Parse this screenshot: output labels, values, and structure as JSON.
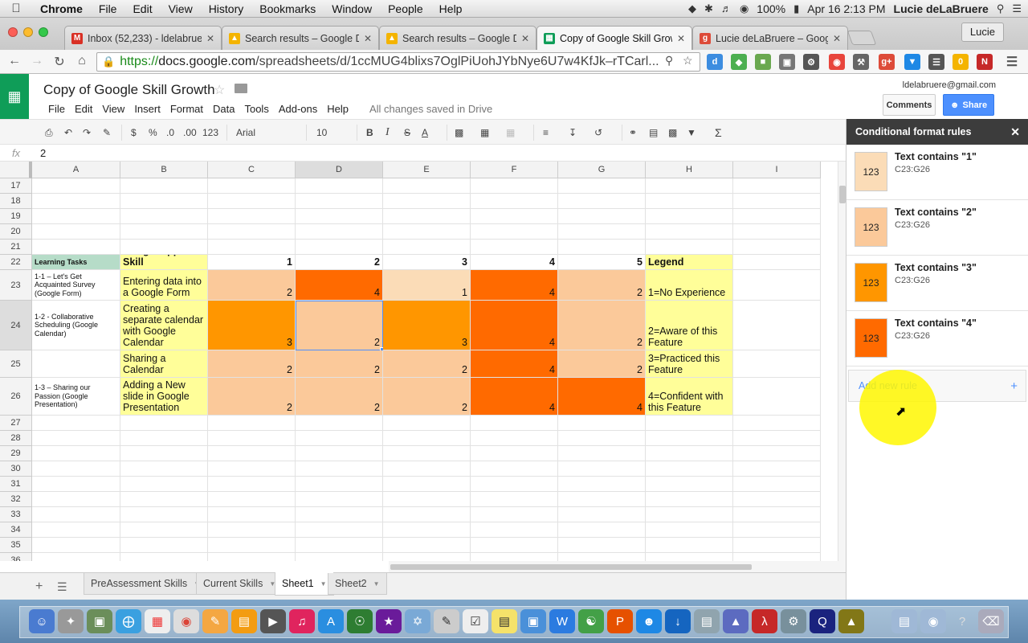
{
  "menubar": {
    "app": "Chrome",
    "items": [
      "File",
      "Edit",
      "View",
      "History",
      "Bookmarks",
      "Window",
      "People",
      "Help"
    ],
    "battery": "100%",
    "datetime": "Apr 16  2:13 PM",
    "user": "Lucie deLaBruere"
  },
  "tabs": [
    {
      "title": "Inbox (52,233) - ldelabrue",
      "icon": "gmail-icon",
      "color": "#d93025"
    },
    {
      "title": "Search results – Google Dr",
      "icon": "drive-icon",
      "color": "#f4b400"
    },
    {
      "title": "Search results – Google Dr",
      "icon": "drive-icon",
      "color": "#f4b400"
    },
    {
      "title": "Copy of Google Skill Growt",
      "icon": "sheets-icon",
      "color": "#0f9d58"
    },
    {
      "title": "Lucie deLaBruere – Google",
      "icon": "gplus-icon",
      "color": "#dd4b39"
    }
  ],
  "profile_button": "Lucie",
  "url": {
    "https": "https://",
    "domain": "docs.google.com",
    "path": "/spreadsheets/d/1ccMUG4blixs7OglPiUohJYbNye6U7w4KfJk–rTCarl..."
  },
  "doc": {
    "title": "Copy of Google Skill Growth",
    "menu": [
      "File",
      "Edit",
      "View",
      "Insert",
      "Format",
      "Data",
      "Tools",
      "Add-ons",
      "Help"
    ],
    "saved": "All changes saved in Drive",
    "account": "ldelabruere@gmail.com",
    "comments": "Comments",
    "share": "Share"
  },
  "toolbar": {
    "currency": "$",
    "percent": "%",
    "dec_less": ".0",
    "dec_more": ".00",
    "format": "123",
    "font": "Arial",
    "size": "10"
  },
  "formula": {
    "fx": "fx",
    "value": "2"
  },
  "columns": [
    "A",
    "B",
    "C",
    "D",
    "E",
    "F",
    "G",
    "H",
    "I"
  ],
  "rows_before": [
    "17",
    "18",
    "19",
    "20",
    "21"
  ],
  "table": {
    "header": {
      "row": "22",
      "a": "Learning Tasks",
      "b": "Google Apps Skill",
      "c": "1",
      "d": "2",
      "e": "3",
      "f": "4",
      "g": "5",
      "h": "Legend"
    },
    "rows": [
      {
        "row": "23",
        "a": "1-1 – Let's Get Acquainted Survey (Google Form)",
        "b": "Entering data into a Google Form",
        "c": "2",
        "d": "4",
        "e": "1",
        "f": "4",
        "g": "2",
        "h": "1=No Experience"
      },
      {
        "row": "24",
        "a": "1-2 -  Collaborative Scheduling (Google Calendar)",
        "b": "Creating a separate calendar with Google Calendar",
        "c": "3",
        "d": "2",
        "e": "3",
        "f": "4",
        "g": "2",
        "h": "2=Aware of this Feature"
      },
      {
        "row": "25",
        "a": "",
        "b": "Sharing a Calendar",
        "c": "2",
        "d": "2",
        "e": "2",
        "f": "4",
        "g": "2",
        "h": "3=Practiced this Feature"
      },
      {
        "row": "26",
        "a": "1-3 – Sharing our Passion (Google Presentation)",
        "b": "Adding a New slide in Google Presentation",
        "c": "2",
        "d": "2",
        "e": "2",
        "f": "4",
        "g": "4",
        "h": "4=Confident with this Feature"
      }
    ]
  },
  "rows_after": [
    "27",
    "28",
    "29",
    "30",
    "31",
    "32",
    "33",
    "34",
    "35",
    "36"
  ],
  "colors": {
    "c1": "#fbdcb7",
    "c2": "#fbc99a",
    "c3": "#ff9600",
    "c4": "#ff6a00",
    "yellow": "#fffe99",
    "green": "#b6dcc8",
    "accent": "#4d90fe"
  },
  "sheet_tabs": [
    "PreAssessment Skills",
    "Current Skills",
    "Sheet1",
    "Sheet2"
  ],
  "active_sheet": "Sheet1",
  "cf_panel": {
    "title": "Conditional format rules",
    "swatch_text": "123",
    "rules": [
      {
        "text": "Text contains \"1\"",
        "range": "C23:G26",
        "color": "#fbdcb7"
      },
      {
        "text": "Text contains \"2\"",
        "range": "C23:G26",
        "color": "#fbc99a"
      },
      {
        "text": "Text contains \"3\"",
        "range": "C23:G26",
        "color": "#ff9600"
      },
      {
        "text": "Text contains \"4\"",
        "range": "C23:G26",
        "color": "#ff6a00"
      }
    ],
    "add_rule": "Add new rule"
  }
}
